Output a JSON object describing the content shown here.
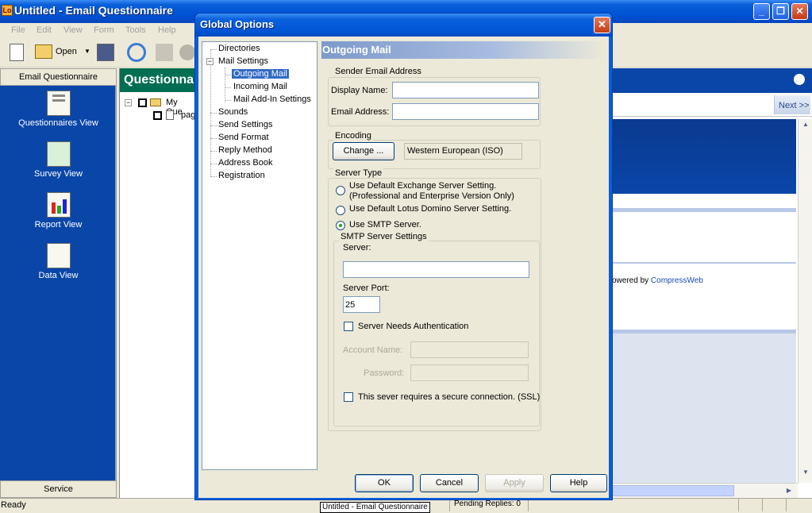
{
  "window": {
    "app_icon_text": "Lo",
    "title": "Untitled - Email Questionnaire",
    "menu": [
      "File",
      "Edit",
      "View",
      "Form",
      "Tools",
      "Help"
    ],
    "toolbar": {
      "open_label": "Open"
    }
  },
  "leftnav": {
    "header": "Email Questionnaire",
    "items": [
      {
        "label": "Questionnaires View",
        "icon": "questionnaire-icon"
      },
      {
        "label": "Survey View",
        "icon": "survey-icon"
      },
      {
        "label": "Report View",
        "icon": "report-icon"
      },
      {
        "label": "Data View",
        "icon": "data-icon"
      }
    ],
    "footer": "Service"
  },
  "tree_pane": {
    "header": "Questionna",
    "root_label": "My Que",
    "child_label": "pag"
  },
  "right_pane": {
    "next_label": "Next >>",
    "powered_by_prefix": "owered by",
    "powered_by_link": "CompressWeb"
  },
  "statusbar": {
    "status": "Ready",
    "taskbar_title": "Untitled - Email Questionnaire",
    "pending": "Pending Replies: 0"
  },
  "dialog": {
    "title": "Global Options",
    "close_glyph": "✕",
    "tree": {
      "items": [
        {
          "label": "Directories"
        },
        {
          "label": "Mail Settings",
          "expander": "−"
        },
        {
          "label": "Outgoing Mail",
          "selected": true
        },
        {
          "label": "Incoming Mail"
        },
        {
          "label": "Mail Add-In Settings"
        },
        {
          "label": "Sounds"
        },
        {
          "label": "Send Settings"
        },
        {
          "label": "Send Format"
        },
        {
          "label": "Reply Method"
        },
        {
          "label": "Address Book"
        },
        {
          "label": "Registration"
        }
      ]
    },
    "panel_title": "Outgoing Mail",
    "sender": {
      "group_label": "Sender Email Address",
      "display_name_label": "Display Name:",
      "display_name_value": "",
      "email_label": "Email Address:",
      "email_value": ""
    },
    "encoding": {
      "group_label": "Encoding",
      "change_button": "Change ...",
      "value": "Western European (ISO)"
    },
    "server_type": {
      "group_label": "Server Type",
      "option1_line1": "Use Default Exchange Server Setting.",
      "option1_line2": "(Professional and Enterprise Version Only)",
      "option2": "Use Default Lotus Domino Server Setting.",
      "option3": "Use SMTP Server.",
      "selected_index": 3
    },
    "smtp": {
      "group_label": "SMTP Server Settings",
      "server_label": "Server:",
      "server_value": "",
      "port_label": "Server Port:",
      "port_value": "25",
      "auth_label": "Server Needs Authentication",
      "account_label": "Account Name:",
      "password_label": "Password:",
      "ssl_label": "This sever requires a secure connection. (SSL)"
    },
    "buttons": {
      "ok": "OK",
      "cancel": "Cancel",
      "apply": "Apply",
      "help": "Help"
    }
  },
  "colors": {
    "xp_blue": "#0a5fd8",
    "nav_blue": "#0a46a8",
    "selection": "#316ac5",
    "questionnaire_header": "#006e50"
  }
}
